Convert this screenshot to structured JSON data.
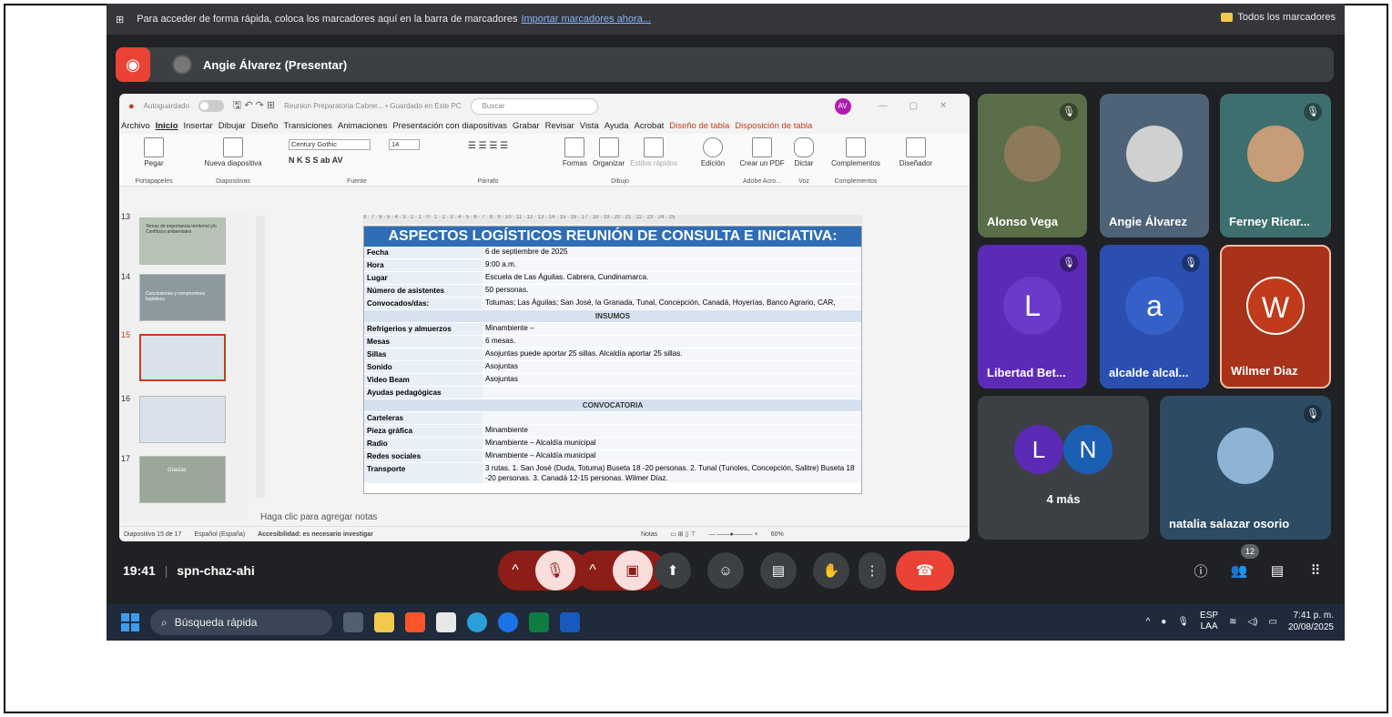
{
  "bookmarks": {
    "text": "Para acceder de forma rápida, coloca los marcadores aquí en la barra de marcadores",
    "import_link": "Importar marcadores ahora...",
    "all": "Todos los marcadores"
  },
  "meet": {
    "presenter": "Angie Álvarez (Presentar)",
    "time": "19:41",
    "code": "spn-chaz-ahi",
    "people_count": "12"
  },
  "ppt": {
    "autosave": "Autoguardado",
    "title": "Reunion Preparatoria Cabrer... • Guardado en Este PC",
    "search": "Buscar",
    "avatar": "AV",
    "menu": [
      "Archivo",
      "Inicio",
      "Insertar",
      "Dibujar",
      "Diseño",
      "Transiciones",
      "Animaciones",
      "Presentación con diapositivas",
      "Grabar",
      "Revisar",
      "Vista",
      "Ayuda",
      "Acrobat",
      "Diseño de tabla",
      "Disposición de tabla"
    ],
    "ribbon": {
      "pegar": "Pegar",
      "portapapeles": "Portapapeles",
      "nueva": "Nueva diapositiva",
      "diapositivas": "Diapositivas",
      "font": "Century Gothic",
      "size": "14",
      "fuente": "Fuente",
      "parrafo": "Párrafo",
      "formas": "Formas",
      "organizar": "Organizar",
      "estilos": "Estilos rápidos",
      "dibujo": "Dibujo",
      "edicion": "Edición",
      "crear": "Crear un PDF",
      "adobe": "Adobe Acro...",
      "dictar": "Dictar",
      "voz": "Voz",
      "complementos": "Complementos",
      "comp_grp": "Complementos",
      "disenador": "Diseñador"
    },
    "thumb_nums": [
      "13",
      "14",
      "15",
      "16",
      "17"
    ],
    "thumb_titles": [
      "Temas de importancia territorial y/o Conflictos ambientales",
      "Conclusiones y compromisos logísticos",
      "",
      "",
      "Gracias"
    ],
    "slide": {
      "title": "ASPECTOS LOGÍSTICOS REUNIÓN DE CONSULTA E INICIATIVA:",
      "rows1": [
        [
          "Fecha",
          "6 de septiembre de 2025"
        ],
        [
          "Hora",
          "9:00 a.m."
        ],
        [
          "Lugar",
          "Escuela de Las Águilas. Cabrera, Cundinamarca."
        ],
        [
          "Número de asistentes",
          "50 personas."
        ],
        [
          "Convocados/das:",
          "Totumas; Las Águilas; San José, la Granada, Tunal, Concepción, Canadá, Hoyerías, Banco Agrario, CAR,"
        ]
      ],
      "sec1": "INSUMOS",
      "rows2": [
        [
          "Refrigerios y almuerzos",
          "Minambiente –"
        ],
        [
          "Mesas",
          "6 mesas."
        ],
        [
          "Sillas",
          "Asojuntas puede aportar 25 sillas. Alcaldía aportar 25 sillas."
        ],
        [
          "Sonido",
          "Asojuntas"
        ],
        [
          "Video Beam",
          "Asojuntas"
        ],
        [
          "Ayudas pedagógicas",
          ""
        ]
      ],
      "sec2": "CONVOCATORIA",
      "rows3": [
        [
          "Carteleras",
          ""
        ],
        [
          "Pieza gráfica",
          "Minambiente"
        ],
        [
          "Radio",
          "Minambiente – Alcaldía municipal"
        ],
        [
          "Redes sociales",
          "Minambiente – Alcaldía municipal"
        ],
        [
          "Transporte",
          "3 rutas. 1. San José (Duda, Totuma) Buseta 18 -20 personas. 2. Tunal (Tunoles, Concepción, Salitre) Buseta 18 -20 personas. 3. Canadá 12-15 personas. Wilmer Díaz."
        ]
      ]
    },
    "notes": "Haga clic para agregar notas",
    "status": {
      "slide": "Diapositiva 15 de 17",
      "lang": "Español (España)",
      "access": "Accesibilidad: es necesario investigar",
      "notes": "Notas",
      "zoom": "60%"
    }
  },
  "tiles": [
    {
      "name": "Alonso Vega"
    },
    {
      "name": "Angie Álvarez"
    },
    {
      "name": "Ferney Ricar..."
    },
    {
      "name": "Libertad Bet...",
      "letter": "L"
    },
    {
      "name": "alcalde alcal...",
      "letter": "a"
    },
    {
      "name": "Wilmer Diaz",
      "letter": "W"
    },
    {
      "name": "4 más",
      "l1": "L",
      "l2": "N"
    },
    {
      "name": "natalia salazar osorio"
    }
  ],
  "taskbar": {
    "search": "Búsqueda rápida",
    "lang1": "ESP",
    "lang2": "LAA",
    "time": "7:41 p. m.",
    "date": "20/08/2025"
  },
  "colors": {
    "accent": "#c43e1c",
    "leave": "#ea4335",
    "purple": "#5b2bb5",
    "blue": "#2a4fb0"
  }
}
